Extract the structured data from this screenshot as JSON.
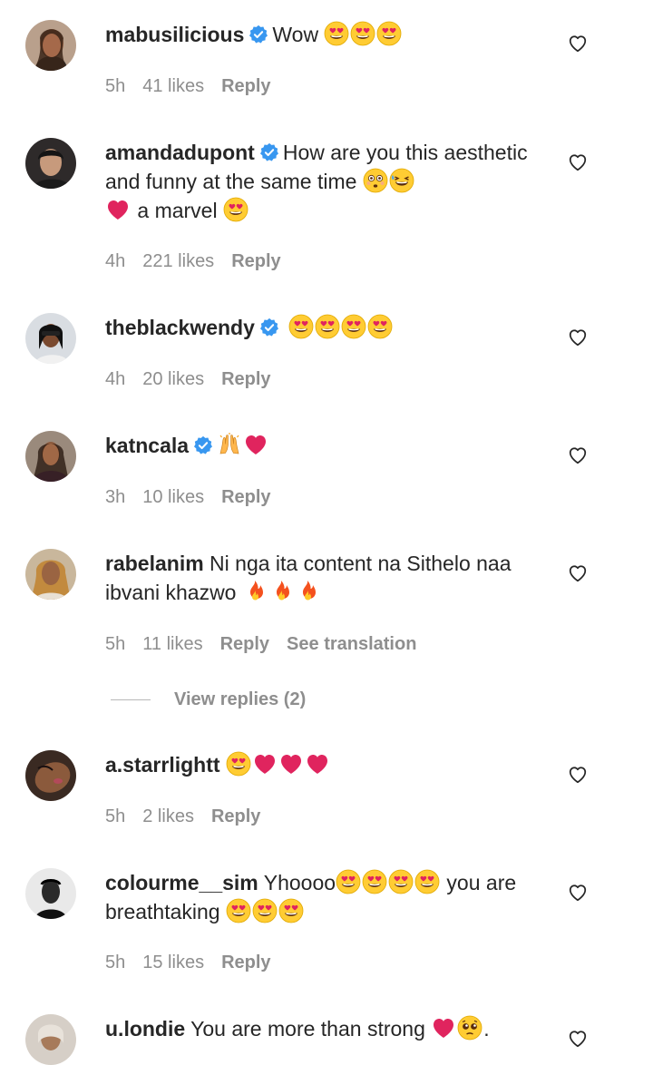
{
  "comments": [
    {
      "username": "mabusilicious",
      "verified": true,
      "text_parts": [
        "Wow "
      ],
      "emojis": [
        "heart-eyes",
        "heart-eyes",
        "heart-eyes"
      ],
      "time": "5h",
      "likes": "41 likes",
      "reply": "Reply"
    },
    {
      "username": "amandadupont",
      "verified": true,
      "text_parts": [
        "How are you this aesthetic and funny at the same time ",
        " a marvel "
      ],
      "time": "4h",
      "likes": "221 likes",
      "reply": "Reply"
    },
    {
      "username": "theblackwendy",
      "verified": true,
      "time": "4h",
      "likes": "20 likes",
      "reply": "Reply"
    },
    {
      "username": "katncala",
      "verified": true,
      "time": "3h",
      "likes": "10 likes",
      "reply": "Reply"
    },
    {
      "username": "rabelanim",
      "verified": false,
      "text_parts": [
        "Ni nga ita content na Sithelo naa ibvani khazwo "
      ],
      "time": "5h",
      "likes": "11 likes",
      "reply": "Reply",
      "translate": "See translation"
    },
    {
      "username": "a.starrlightt",
      "verified": false,
      "time": "5h",
      "likes": "2 likes",
      "reply": "Reply"
    },
    {
      "username": "colourme__sim",
      "verified": false,
      "text_parts": [
        "Yhoooo",
        " you are breathtaking "
      ],
      "time": "5h",
      "likes": "15 likes",
      "reply": "Reply"
    },
    {
      "username": "u.londie",
      "verified": false,
      "text_parts": [
        "You are more than strong ",
        "."
      ]
    }
  ],
  "view_replies": "View replies (2)",
  "colors": {
    "text": "#262626",
    "meta": "#8e8e8e",
    "verified": "#3897f0",
    "heart_emoji": "#e0245e",
    "face_emoji": "#ffcc33"
  }
}
